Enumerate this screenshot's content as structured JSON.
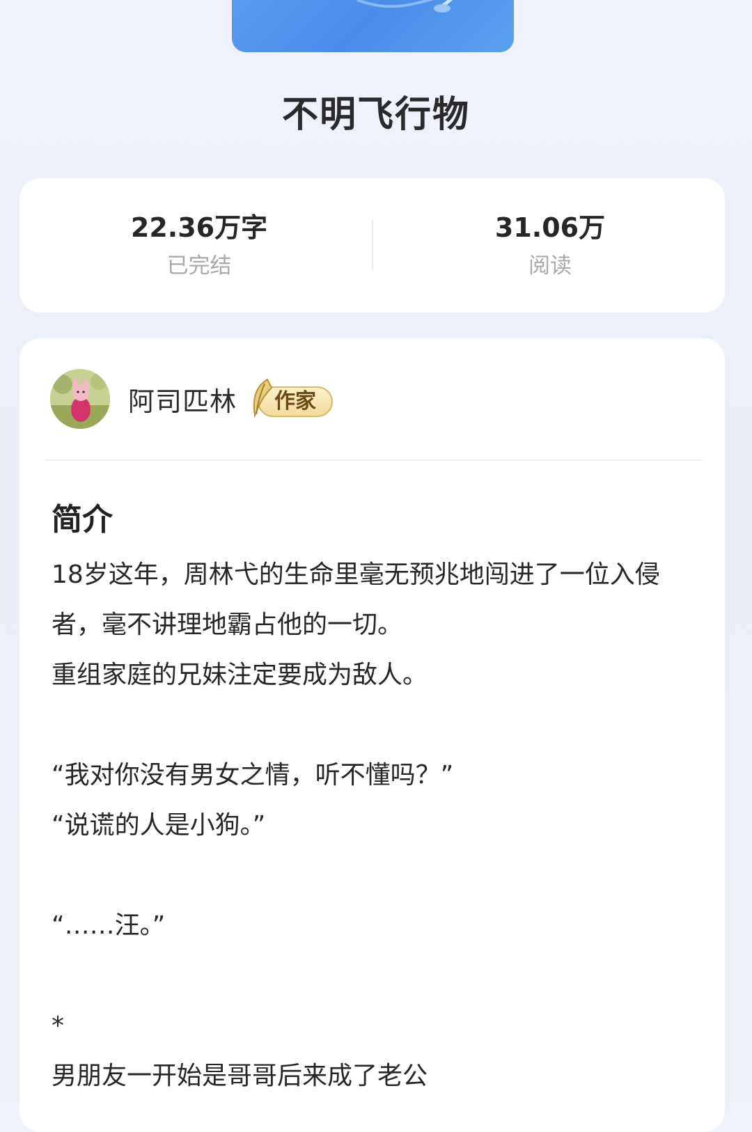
{
  "book": {
    "title": "不明飞行物"
  },
  "stats": {
    "word_count": "22.36万字",
    "status": "已完结",
    "reads": "31.06万",
    "reads_label": "阅读"
  },
  "author": {
    "name": "阿司匹林",
    "badge": "作家"
  },
  "intro": {
    "heading": "简介",
    "lines": [
      "18岁这年，周林弋的生命里毫无预兆地闯进了一位入侵者，毫不讲理地霸占他的一切。",
      "重组家庭的兄妹注定要成为敌人。",
      "",
      "“我对你没有男女之情，听不懂吗？”",
      "“说谎的人是小狗。”",
      "",
      "“……汪。”",
      "",
      "*",
      "男朋友一开始是哥哥后来成了老公"
    ]
  },
  "colors": {
    "cover_blue": "#4a8ce8",
    "badge_gold": "#f1dc9a",
    "muted_text": "#a9a9a9"
  }
}
